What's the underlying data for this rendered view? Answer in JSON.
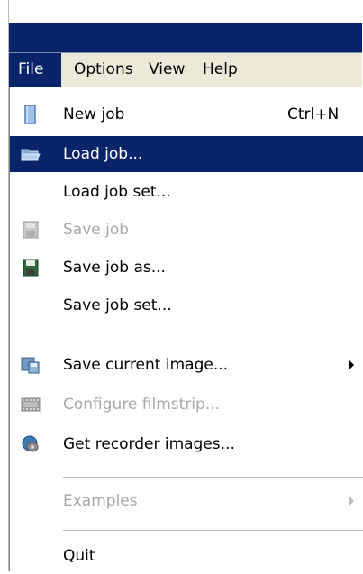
{
  "menubar": {
    "items": [
      {
        "label": "File"
      },
      {
        "label": "Options"
      },
      {
        "label": "View"
      },
      {
        "label": "Help"
      }
    ]
  },
  "file_menu": {
    "new_job": {
      "label": "New job",
      "shortcut": "Ctrl+N",
      "icon": "new-document-icon"
    },
    "load_job": {
      "label": "Load job...",
      "icon": "open-folder-icon"
    },
    "load_job_set": {
      "label": "Load job set..."
    },
    "save_job": {
      "label": "Save job",
      "icon": "floppy-disk-icon"
    },
    "save_job_as": {
      "label": "Save job as...",
      "icon": "floppy-disk-save-as-icon"
    },
    "save_job_set": {
      "label": "Save job set..."
    },
    "save_current_image": {
      "label": "Save current image...",
      "icon": "save-image-icon"
    },
    "configure_filmstrip": {
      "label": "Configure filmstrip...",
      "icon": "filmstrip-icon"
    },
    "get_recorder_images": {
      "label": "Get recorder images...",
      "icon": "recorder-icon"
    },
    "examples": {
      "label": "Examples"
    },
    "quit": {
      "label": "Quit"
    }
  },
  "colors": {
    "highlight": "#0a246a",
    "menubar_bg": "#ece9d8",
    "disabled_text": "#a8a8a8"
  }
}
